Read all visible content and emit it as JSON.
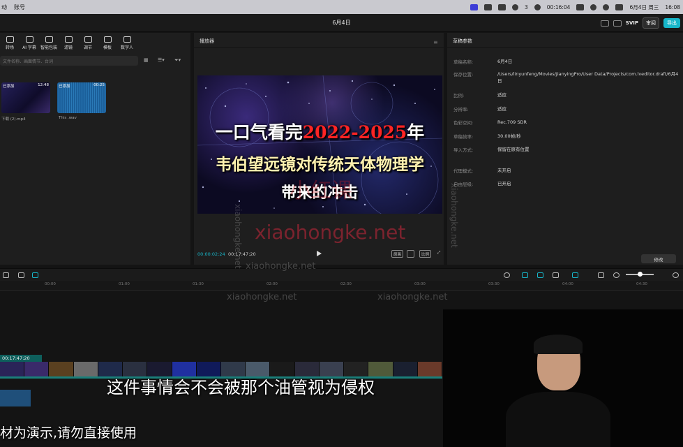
{
  "menubar": {
    "left_items": [
      "动",
      "账号"
    ],
    "date": "6月4日 周三",
    "time": "16:08",
    "recording_time": "00:16:04",
    "wechat_count": "3",
    "icons": [
      "screen-record-icon",
      "browser-icon",
      "tiktok-icon",
      "wechat-icon",
      "stop-icon",
      "volume-icon",
      "wifi-icon",
      "search-icon",
      "control-center-icon"
    ]
  },
  "titlebar": {
    "title": "6月4日",
    "svip": "SVIP",
    "review_label": "审阅",
    "export_label": "导出"
  },
  "media_panel": {
    "tools": [
      "转场",
      "AI 字幕",
      "智能包装",
      "滤镜",
      "调节",
      "模板",
      "数字人"
    ],
    "search_placeholder": "文件名称、画面情节、台词",
    "items": [
      {
        "badge": "已添加",
        "duration": "12:48",
        "name": "下载 (2).mp4"
      },
      {
        "badge": "已添加",
        "duration": "00:25",
        "name": "This .wav"
      }
    ]
  },
  "player": {
    "title": "播放器",
    "video_line1_white": "一口气看完",
    "video_line1_red": "2022-2025",
    "video_line1_end": "年",
    "video_line2": "韦伯望远镜对传统天体物理学",
    "video_line3": "带来的冲击",
    "current_time": "00:00:02:24",
    "total_time": "00:17:47:20",
    "ctrl_original": "原画",
    "ctrl_ratio": "比例"
  },
  "properties": {
    "title": "草稿参数",
    "rows": [
      {
        "label": "草稿名称:",
        "value": "6月4日"
      },
      {
        "label": "保存位置:",
        "value": "/Users/linyunfeng/Movies/JianyingPro/User Data/Projects/com.lveditor.draft/6月4日"
      },
      {
        "label": "比例:",
        "value": "适应"
      },
      {
        "label": "分辨率:",
        "value": "适应"
      },
      {
        "label": "色彩空间:",
        "value": "Rec.709 SDR"
      },
      {
        "label": "草稿帧率:",
        "value": "30.00帧/秒"
      },
      {
        "label": "导入方式:",
        "value": "保留在原有位置"
      },
      {
        "label": "代理模式:",
        "value": "未开启"
      },
      {
        "label": "自由层级:",
        "value": "已开启"
      }
    ],
    "modify_label": "修改"
  },
  "timeline": {
    "ticks": [
      "00:00",
      "01:00",
      "01:30",
      "02:00",
      "02:30",
      "03:00",
      "03:30",
      "04:00",
      "04:30"
    ],
    "track_duration": "00:17:47:20"
  },
  "watermarks": {
    "big": "xiaohongke.net",
    "small": "xiaohongke.net",
    "cn": "小红课"
  },
  "subtitle": "这件事情会不会被那个油管视为侵权",
  "disclaimer": "材为演示,请勿直接使用",
  "colors": {
    "accent": "#17b6c9",
    "red_text": "#ff2424",
    "track": "#1a7f7a"
  }
}
